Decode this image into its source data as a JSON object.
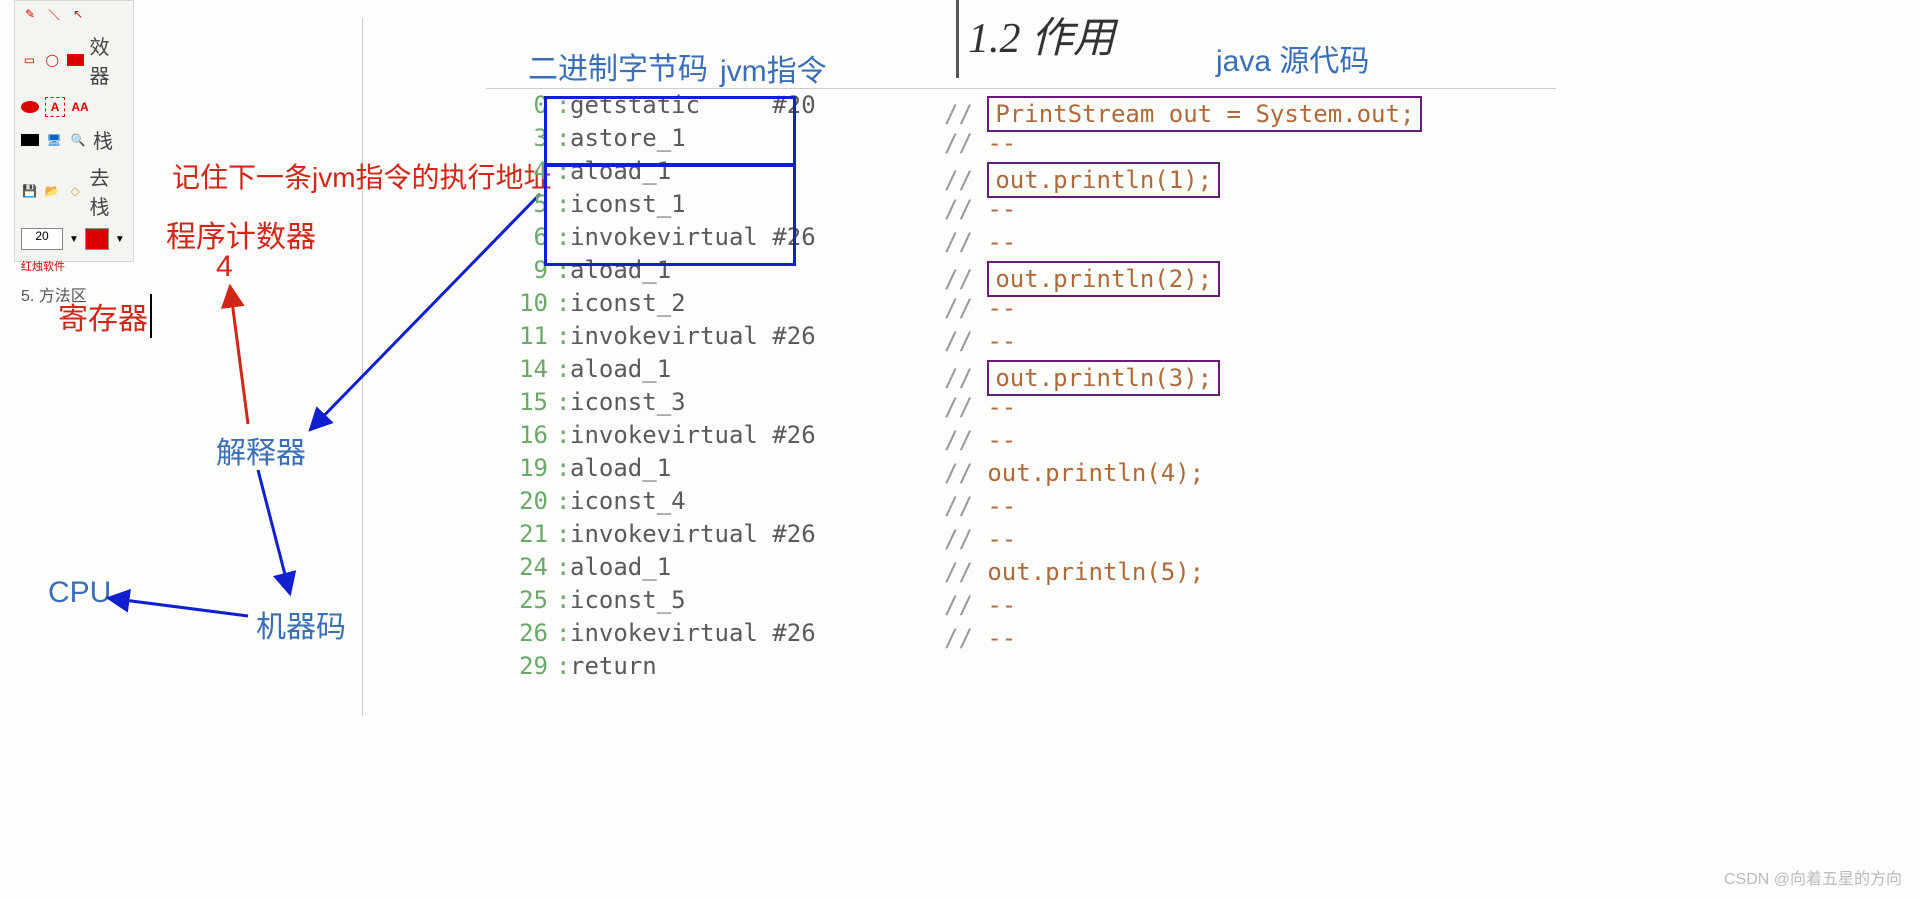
{
  "toolbox": {
    "font_size": "20",
    "brand": "红烛软件",
    "labels": {
      "r1": "效器",
      "r2": "栈",
      "r3": "去栈",
      "r4": "5. 方法区"
    }
  },
  "headers": {
    "bytecode": "二进制字节码",
    "jvm": "jvm指令",
    "section": "1.2 作用",
    "java_src": "java 源代码"
  },
  "annotations": {
    "remember": "记住下一条jvm指令的执行地址",
    "pc": "程序计数器",
    "pc_val": "4",
    "register": "寄存器",
    "interpreter": "解释器",
    "machine_code": "机器码",
    "cpu": "CPU"
  },
  "code": [
    {
      "addr": "0",
      "instr": "getstatic     #20",
      "comment": "PrintStream out = System.out;",
      "boxed": true
    },
    {
      "addr": "3",
      "instr": "astore_1",
      "comment": "--"
    },
    {
      "addr": "4",
      "instr": "aload_1",
      "comment": "out.println(1);",
      "boxed": true
    },
    {
      "addr": "5",
      "instr": "iconst_1",
      "comment": "--"
    },
    {
      "addr": "6",
      "instr": "invokevirtual #26",
      "comment": "--"
    },
    {
      "addr": "9",
      "instr": "aload_1",
      "comment": "out.println(2);",
      "boxed": true
    },
    {
      "addr": "10",
      "instr": "iconst_2",
      "comment": "--"
    },
    {
      "addr": "11",
      "instr": "invokevirtual #26",
      "comment": "--"
    },
    {
      "addr": "14",
      "instr": "aload_1",
      "comment": "out.println(3);",
      "boxed": true
    },
    {
      "addr": "15",
      "instr": "iconst_3",
      "comment": "--"
    },
    {
      "addr": "16",
      "instr": "invokevirtual #26",
      "comment": "--"
    },
    {
      "addr": "19",
      "instr": "aload_1",
      "comment": "out.println(4);"
    },
    {
      "addr": "20",
      "instr": "iconst_4",
      "comment": "--"
    },
    {
      "addr": "21",
      "instr": "invokevirtual #26",
      "comment": "--"
    },
    {
      "addr": "24",
      "instr": "aload_1",
      "comment": "out.println(5);"
    },
    {
      "addr": "25",
      "instr": "iconst_5",
      "comment": "--"
    },
    {
      "addr": "26",
      "instr": "invokevirtual #26",
      "comment": "--"
    },
    {
      "addr": "29",
      "instr": "return"
    }
  ],
  "watermark": "CSDN @向着五星的方向"
}
